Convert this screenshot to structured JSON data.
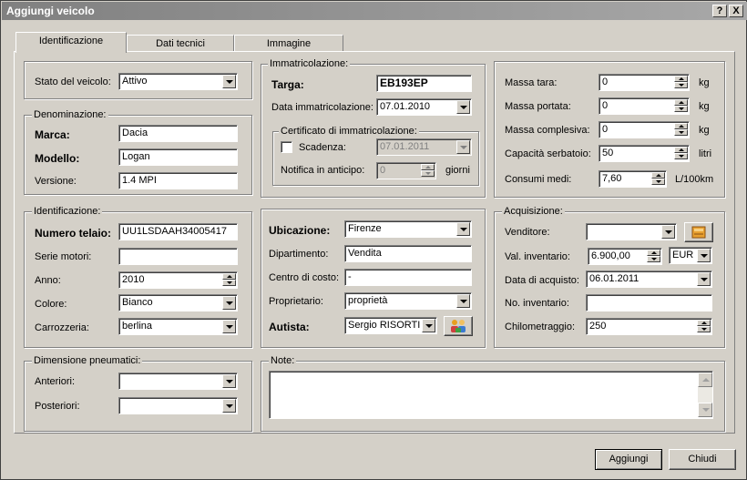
{
  "window": {
    "title": "Aggiungi veicolo",
    "help_label": "?",
    "close_label": "X"
  },
  "tabs": [
    {
      "label": "Identificazione",
      "active": true
    },
    {
      "label": "Dati tecnici"
    },
    {
      "label": "Immagine"
    }
  ],
  "stato": {
    "label": "Stato del veicolo:",
    "value": "Attivo"
  },
  "denominazione": {
    "title": "Denominazione:",
    "marca_label": "Marca:",
    "marca": "Dacia",
    "modello_label": "Modello:",
    "modello": "Logan",
    "versione_label": "Versione:",
    "versione": "1.4 MPI"
  },
  "immatricolazione": {
    "title": "Immatricolazione:",
    "targa_label": "Targa:",
    "targa": "EB193EP",
    "data_label": "Data immatricolazione:",
    "data": "07.01.2010",
    "certificato": {
      "title": "Certificato di immatricolazione:",
      "scadenza_label": "Scadenza:",
      "scadenza": "07.01.2011",
      "scadenza_checked": false,
      "notifica_label": "Notifica in anticipo:",
      "notifica": "0",
      "notifica_unit": "giorni"
    }
  },
  "masse": {
    "tara_label": "Massa tara:",
    "tara": "0",
    "portata_label": "Massa portata:",
    "portata": "0",
    "complesiva_label": "Massa complesiva:",
    "complesiva": "0",
    "unit_kg": "kg",
    "serbatoio_label": "Capacità serbatoio:",
    "serbatoio": "50",
    "unit_litri": "litri",
    "consumi_label": "Consumi medi:",
    "consumi": "7,60",
    "unit_consumi": "L/100km"
  },
  "identificazione": {
    "title": "Identificazione:",
    "telaio_label": "Numero telaio:",
    "telaio": "UU1LSDAAH34005417",
    "serie_label": "Serie motori:",
    "serie": "",
    "anno_label": "Anno:",
    "anno": "2010",
    "colore_label": "Colore:",
    "colore": "Bianco",
    "carrozzeria_label": "Carrozzeria:",
    "carrozzeria": "berlina"
  },
  "ubicazione": {
    "ubicazione_label": "Ubicazione:",
    "ubicazione": "Firenze",
    "dipartimento_label": "Dipartimento:",
    "dipartimento": "Vendita",
    "centro_label": "Centro di costo:",
    "centro": "-",
    "proprietario_label": "Proprietario:",
    "proprietario": "proprietà",
    "autista_label": "Autista:",
    "autista": "Sergio RISORTI"
  },
  "acquisizione": {
    "title": "Acquisizione:",
    "venditore_label": "Venditore:",
    "venditore": "",
    "val_label": "Val. inventario:",
    "val": "6.900,00",
    "valuta": "EUR",
    "data_label": "Data di acquisto:",
    "data": "06.01.2011",
    "no_label": "No. inventario:",
    "no": "",
    "km_label": "Chilometraggio:",
    "km": "250"
  },
  "pneumatici": {
    "title": "Dimensione pneumatici:",
    "anteriori_label": "Anteriori:",
    "anteriori": "",
    "posteriori_label": "Posteriori:",
    "posteriori": ""
  },
  "note": {
    "title": "Note:",
    "value": ""
  },
  "buttons": {
    "add": "Aggiungi",
    "close": "Chiudi"
  },
  "icons": {
    "venditore_lookup": "address-book-icon",
    "autista_lookup": "people-icon"
  }
}
